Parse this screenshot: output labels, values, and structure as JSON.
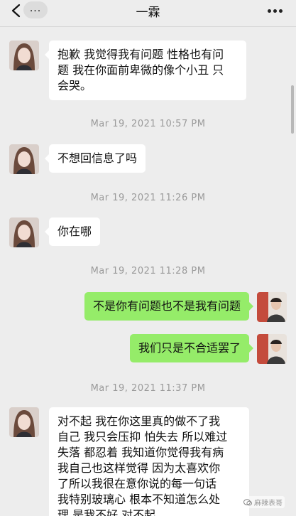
{
  "header": {
    "title": "一霖",
    "unread_label": "...",
    "back_icon": "chevron-left-icon",
    "more_icon": "more-dots-icon"
  },
  "messages": [
    {
      "side": "left",
      "text": "抱歉 我觉得我有问题 性格也有问\n题 我在你面前卑微的像个小丑 只\n会哭。"
    },
    {
      "type": "time",
      "text": "Mar 19, 2021 10:57 PM"
    },
    {
      "side": "left",
      "text": "不想回信息了吗"
    },
    {
      "type": "time",
      "text": "Mar 19, 2021 11:26 PM"
    },
    {
      "side": "left",
      "text": "你在哪"
    },
    {
      "type": "time",
      "text": "Mar 19, 2021 11:28 PM"
    },
    {
      "side": "right",
      "text": "不是你有问题也不是我有问题"
    },
    {
      "side": "right",
      "text": "我们只是不合适罢了"
    },
    {
      "type": "time",
      "text": "Mar 19, 2021 11:37 PM"
    },
    {
      "side": "left",
      "text": "对不起 我在你这里真的做不了我\n自己 我只会压抑 怕失去 所以难过\n失落 都忍着 我知道你觉得我有病\n我自己也这样觉得 因为太喜欢你\n了所以我很在意你说的每一句话\n我特别玻璃心 根本不知道怎么处\n理 是我不好 对不起"
    }
  ],
  "watermark": {
    "text": "麻辣表哥"
  },
  "colors": {
    "background": "#ededed",
    "bubble_incoming": "#ffffff",
    "bubble_outgoing": "#95ec69",
    "timestamp": "#9a9a9a"
  }
}
